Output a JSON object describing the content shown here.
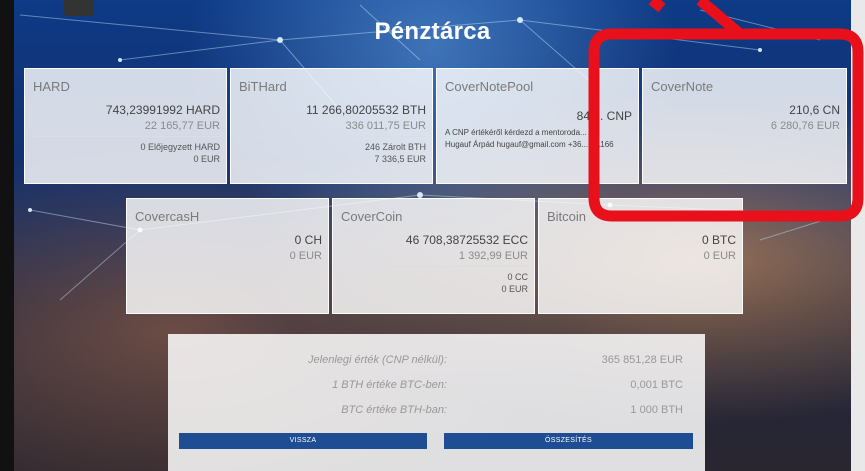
{
  "page": {
    "title": "Pénztárca"
  },
  "cards_top": [
    {
      "name": "HARD",
      "amount": "743,23991992 HARD",
      "eur": "22 165,77 EUR",
      "sub1": "0 Előjegyzett HARD",
      "sub2": "0 EUR"
    },
    {
      "name": "BiTHard",
      "amount": "11 266,80205532 BTH",
      "eur": "336 011,75 EUR",
      "sub1": "246 Zárolt BTH",
      "sub2": "7 336,5 EUR"
    },
    {
      "name": "CoverNotePool",
      "amount": "84 ... CNP",
      "note1": "A CNP értékéről kérdezd a mentoroda...",
      "note2": "Hugauf Árpád hugauf@gmail.com +36...011166"
    },
    {
      "name": "CoverNote",
      "amount": "210,6 CN",
      "eur": "6 280,76 EUR"
    }
  ],
  "cards_mid": [
    {
      "name": "CovercasH",
      "amount": "0 CH",
      "eur": "0 EUR"
    },
    {
      "name": "CoverCoin",
      "amount": "46 708,38725532 ECC",
      "eur": "1 392,99 EUR",
      "sub1": "0 CC",
      "sub2": "0 EUR"
    },
    {
      "name": "Bitcoin",
      "amount": "0 BTC",
      "eur": "0 EUR"
    }
  ],
  "summary": {
    "rows": [
      {
        "label": "Jelenlegi érték (CNP nélkül):",
        "value": "365 851,28 EUR"
      },
      {
        "label": "1 BTH értéke BTC-ben:",
        "value": "0,001 BTC"
      },
      {
        "label": "BTC értéke BTH-ban:",
        "value": "1 000 BTH"
      }
    ],
    "back_label": "VISSZA",
    "summary_label": "ÖSSZESÍTÉS"
  },
  "annotation": {
    "color": "#e8101a"
  }
}
